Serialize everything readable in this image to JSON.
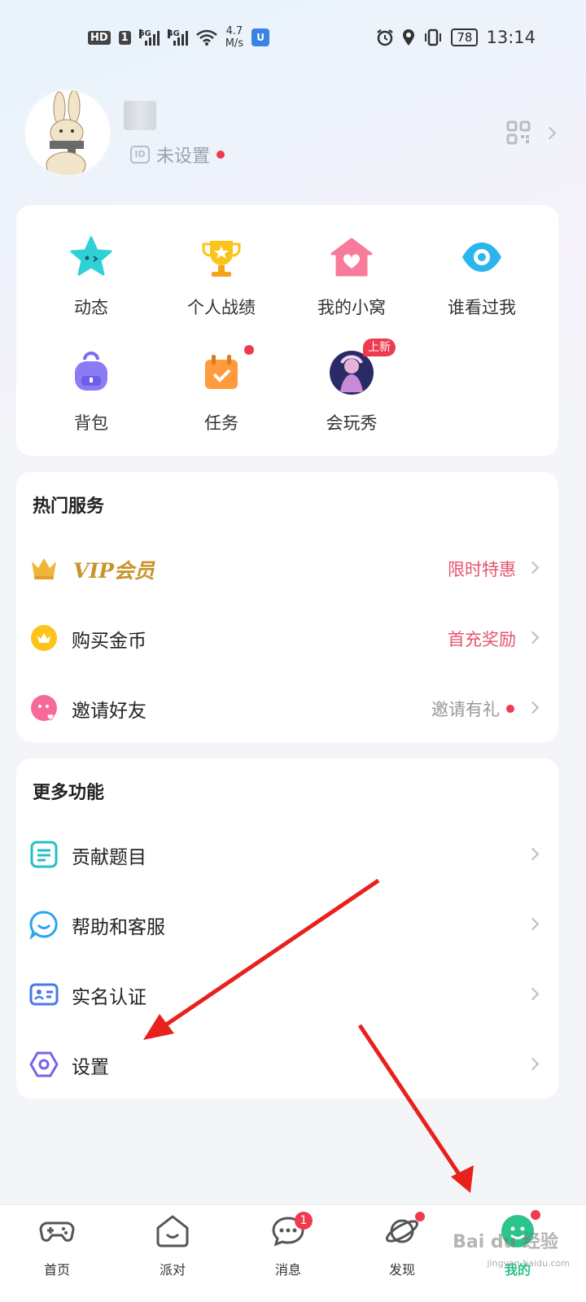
{
  "status_bar": {
    "hd": "HD",
    "sim1": "1",
    "net1": "5G",
    "net2": "4G",
    "speed_value": "4.7",
    "speed_unit": "M/s",
    "battery": "78",
    "time": "13:14"
  },
  "profile": {
    "id_label": "ID",
    "id_text": "未设置"
  },
  "quick_grid": [
    {
      "label": "动态",
      "icon": "star-face-icon"
    },
    {
      "label": "个人战绩",
      "icon": "trophy-icon"
    },
    {
      "label": "我的小窝",
      "icon": "house-heart-icon"
    },
    {
      "label": "谁看过我",
      "icon": "eye-icon"
    },
    {
      "label": "背包",
      "icon": "backpack-icon"
    },
    {
      "label": "任务",
      "icon": "calendar-check-icon"
    },
    {
      "label": "会玩秀",
      "icon": "character-avatar-icon",
      "badge": "上新"
    }
  ],
  "hot_services": {
    "title": "热门服务",
    "items": [
      {
        "label": "VIP会员",
        "value": "限时特惠",
        "value_color": "#e8536d",
        "icon": "crown-icon"
      },
      {
        "label": "购买金币",
        "value": "首充奖励",
        "value_color": "#e8536d",
        "icon": "gold-coin-icon"
      },
      {
        "label": "邀请好友",
        "value": "邀请有礼",
        "value_color": "#999999",
        "icon": "pink-face-icon"
      }
    ]
  },
  "more_features": {
    "title": "更多功能",
    "items": [
      {
        "label": "贡献题目",
        "icon": "document-icon"
      },
      {
        "label": "帮助和客服",
        "icon": "chat-smile-icon"
      },
      {
        "label": "实名认证",
        "icon": "id-card-icon"
      },
      {
        "label": "设置",
        "icon": "settings-hexagon-icon"
      }
    ]
  },
  "tabbar": {
    "tabs": [
      {
        "label": "首页",
        "icon": "gamepad-icon"
      },
      {
        "label": "派对",
        "icon": "party-icon"
      },
      {
        "label": "消息",
        "icon": "message-icon",
        "badge": "1"
      },
      {
        "label": "发现",
        "icon": "planet-icon"
      },
      {
        "label": "我的",
        "icon": "me-icon",
        "active": true
      }
    ]
  },
  "watermark": {
    "brand": "Bai du 经验",
    "url": "jingyan.baidu.com"
  },
  "colors": {
    "accent_green": "#2bc48a",
    "badge_red": "#ee3b4f",
    "vip_gold": "#c9942a",
    "annotation_red": "#e8211d"
  }
}
